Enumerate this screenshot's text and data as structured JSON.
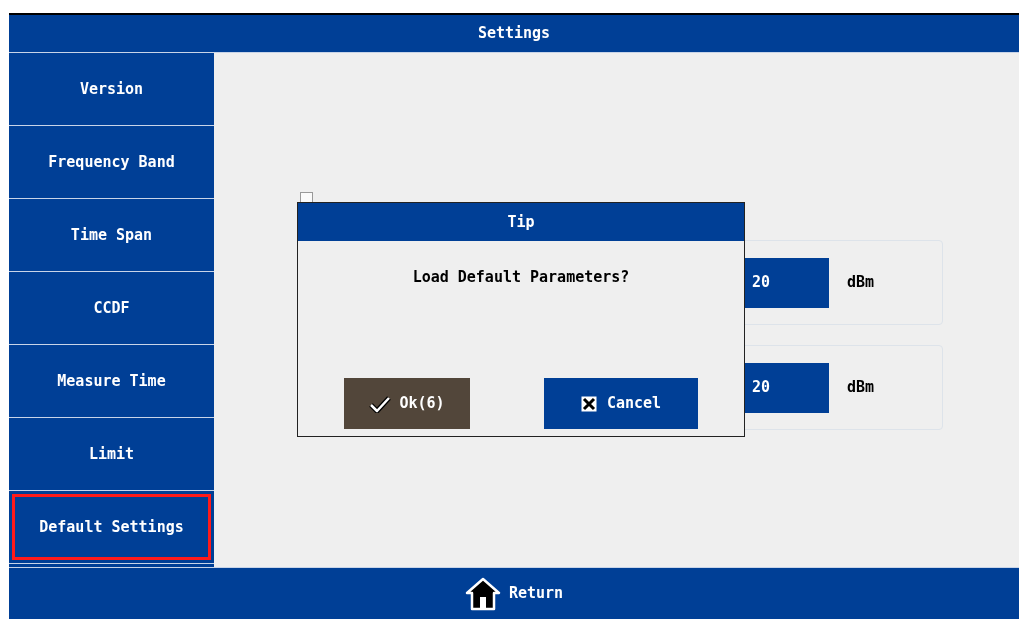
{
  "window": {
    "title": "Settings"
  },
  "sidebar": {
    "items": [
      {
        "label": "Version",
        "selected": false
      },
      {
        "label": "Frequency Band",
        "selected": false
      },
      {
        "label": "Time Span",
        "selected": false
      },
      {
        "label": "CCDF",
        "selected": false
      },
      {
        "label": "Measure Time",
        "selected": false
      },
      {
        "label": "Limit",
        "selected": false
      },
      {
        "label": "Default Settings",
        "selected": true
      }
    ]
  },
  "content": {
    "enable": {
      "checked": false
    },
    "rows": [
      {
        "value": "20",
        "unit": "dBm"
      },
      {
        "value": "20",
        "unit": "dBm"
      }
    ]
  },
  "dialog": {
    "title": "Tip",
    "message": "Load Default Parameters?",
    "buttons": [
      {
        "kind": "ok",
        "label": "Ok(6)"
      },
      {
        "kind": "cancel",
        "label": "Cancel"
      }
    ]
  },
  "footer": {
    "button": "Return"
  }
}
